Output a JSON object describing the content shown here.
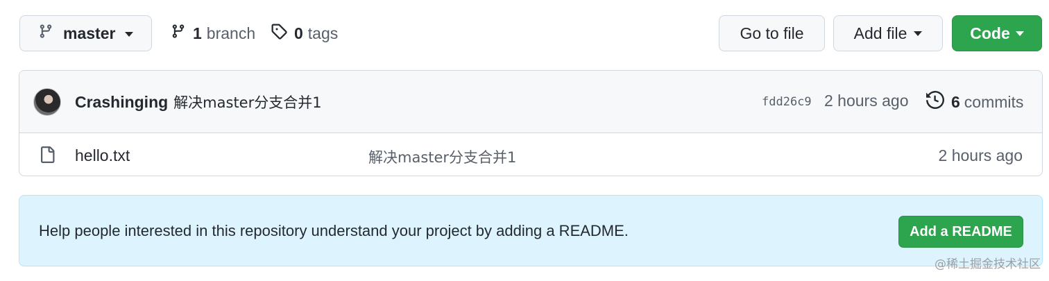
{
  "toolbar": {
    "branch_label": "master",
    "branches": {
      "count": "1",
      "label": "branch"
    },
    "tags": {
      "count": "0",
      "label": "tags"
    },
    "go_to_file": "Go to file",
    "add_file": "Add file",
    "code": "Code"
  },
  "latest_commit": {
    "author": "Crashinging",
    "message": "解决master分支合并1",
    "hash": "fdd26c9",
    "time": "2 hours ago",
    "commits_count": "6",
    "commits_label": "commits"
  },
  "files": [
    {
      "name": "hello.txt",
      "message": "解决master分支合并1",
      "time": "2 hours ago"
    }
  ],
  "readme_banner": {
    "text": "Help people interested in this repository understand your project by adding a README.",
    "button": "Add a README"
  },
  "watermark": "@稀土掘金技术社区",
  "colors": {
    "primary_green": "#2da44e",
    "banner_bg": "#ddf4ff",
    "muted_text": "#57606a"
  }
}
